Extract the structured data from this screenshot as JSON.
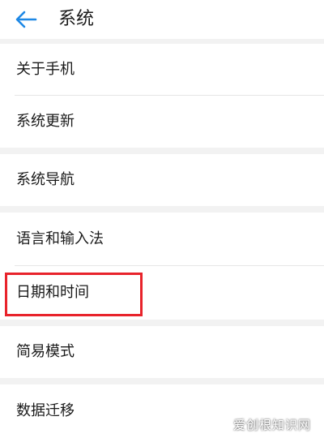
{
  "header": {
    "title": "系统",
    "back_icon": "arrow-left-icon",
    "accent_color": "#1e88e5"
  },
  "groups": [
    {
      "items": [
        {
          "label": "关于手机"
        },
        {
          "label": "系统更新"
        }
      ]
    },
    {
      "items": [
        {
          "label": "系统导航"
        }
      ]
    },
    {
      "items": [
        {
          "label": "语言和输入法"
        },
        {
          "label": "日期和时间"
        }
      ]
    },
    {
      "items": [
        {
          "label": "简易模式"
        }
      ]
    },
    {
      "items": [
        {
          "label": "数据迁移"
        }
      ]
    }
  ],
  "annotation": {
    "highlight_color": "#e8232b",
    "highlighted_item": "日期和时间"
  },
  "watermark": "爱创根知识网"
}
